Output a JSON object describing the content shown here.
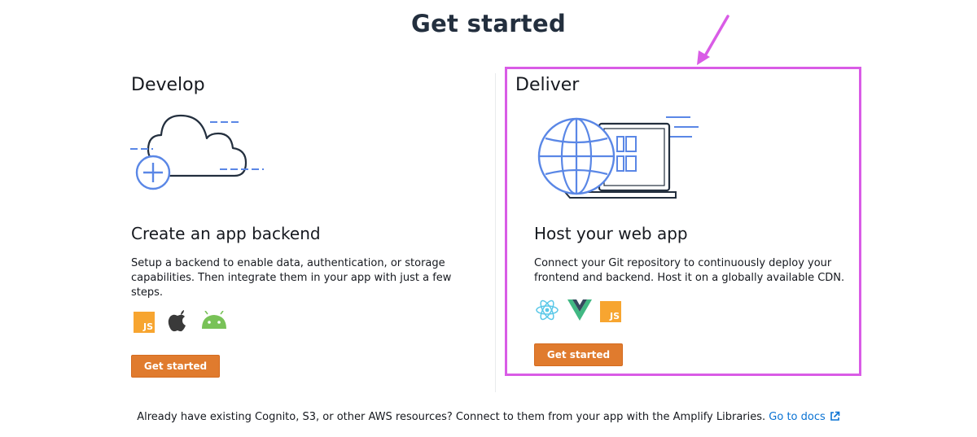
{
  "page": {
    "title": "Get started"
  },
  "develop": {
    "column_title": "Develop",
    "card_heading": "Create an app backend",
    "description": "Setup a backend to enable data, authentication, or storage capabilities. Then integrate them in your app with just a few steps.",
    "platform_icons": [
      "javascript-icon",
      "apple-icon",
      "android-icon"
    ],
    "platform_js_label": "JS",
    "button_label": "Get started"
  },
  "deliver": {
    "column_title": "Deliver",
    "card_heading": "Host your web app",
    "description": "Connect your Git repository to continuously deploy your frontend and backend. Host it on a globally available CDN.",
    "framework_icons": [
      "react-icon",
      "vue-icon",
      "javascript-icon"
    ],
    "framework_js_label": "JS",
    "button_label": "Get started"
  },
  "footer": {
    "text": "Already have existing Cognito, S3, or other AWS resources? Connect to them from your app with the Amplify Libraries.",
    "link_label": "Go to docs"
  },
  "colors": {
    "title": "#232f3e",
    "button": "#e07b2e",
    "link": "#0972d3",
    "highlight": "#d95ce6",
    "illustration_accent": "#5a87e6",
    "illustration_dark": "#232f3e"
  }
}
